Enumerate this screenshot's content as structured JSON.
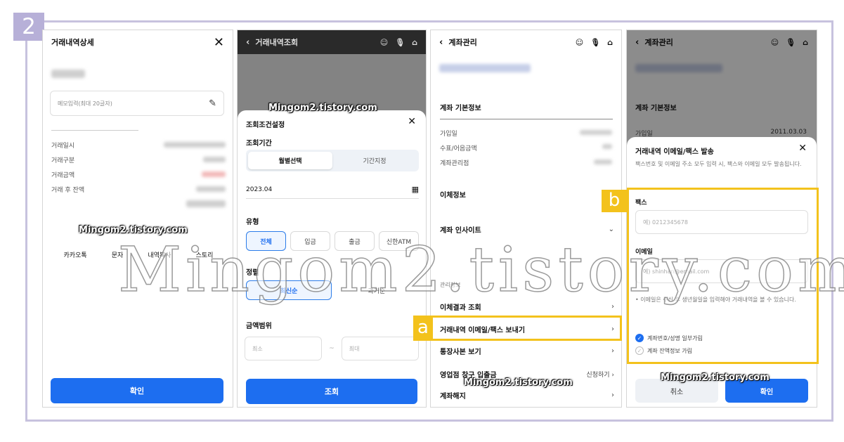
{
  "step_number": "2",
  "colors": {
    "primary_blue": "#1d6ef0",
    "highlight_yellow": "#f3c21c",
    "frame_purple": "#c7c2de"
  },
  "watermark": {
    "small": "Mingom2.tistory.com",
    "large": "Mingom2.tistory.com"
  },
  "panel1": {
    "title": "거래내역상세",
    "memo_placeholder": "메모입력(최대 20글자)",
    "fields": [
      "거래일시",
      "거래구분",
      "거래금액",
      "거래 후 잔액"
    ],
    "share": [
      "카카오톡",
      "문자",
      "내역복사",
      "스토리"
    ],
    "confirm": "확인"
  },
  "panel2": {
    "title": "거래내역조회",
    "sheet_title": "조회조건설정",
    "period_label": "조회기간",
    "period_tabs": [
      "월별선택",
      "기간지정"
    ],
    "month_value": "2023.04",
    "type_label": "유형",
    "types": [
      "전체",
      "입금",
      "출금",
      "신한ATM"
    ],
    "sort_label": "정렬",
    "sorts": [
      "최신순",
      "과거순"
    ],
    "amount_label": "금액범위",
    "amount_min": "최소",
    "amount_sep": "~",
    "amount_max": "최대",
    "submit": "조회"
  },
  "panel3": {
    "title": "계좌관리",
    "section_basic": "계좌 기본정보",
    "basic_fields": [
      "가입일",
      "수표/어음금액",
      "계좌관리점"
    ],
    "transfer_info": "이체정보",
    "insight": "계좌 인사이트",
    "manage_label": "관리정보",
    "menu": [
      "이체결과 조회",
      "거래내역 이메일/팩스 보내기",
      "통장사본 보기",
      "영업점 창구 입출금",
      "계좌해지"
    ],
    "apply": "신청하기",
    "marker": "a"
  },
  "panel4": {
    "title": "계좌관리",
    "section_basic": "계좌 기본정보",
    "join_label": "가입일",
    "join_date": "2011.03.03",
    "dialog_title": "거래내역 이메일/팩스 발송",
    "dialog_desc": "팩스번호 및 이메일 주소 모두 입력 시, 팩스와 이메일 모두 발송됩니다.",
    "fax_label": "팩스",
    "fax_placeholder": "예) 0212345678",
    "email_label": "이메일",
    "email_placeholder": "예) shinhan@email.com",
    "note": "이메일은 수신 후 생년월일을 입력해야 거래내역을 볼 수 있습니다.",
    "options": [
      "계좌번호/성명 일부가림",
      "계좌 잔액정보 가림"
    ],
    "cancel": "취소",
    "confirm": "확인",
    "marker": "b"
  }
}
